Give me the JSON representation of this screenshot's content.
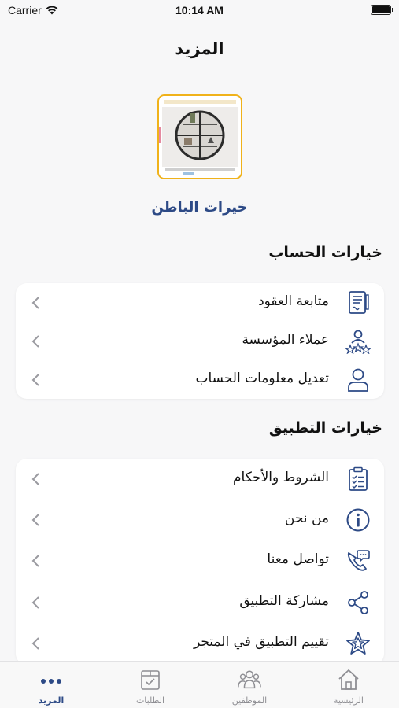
{
  "status": {
    "carrier": "Carrier",
    "time": "10:14 AM"
  },
  "header": {
    "title": "المزيد"
  },
  "profile": {
    "name": "خيرات الباطن"
  },
  "account_section": {
    "title": "خيارات الحساب",
    "items": [
      {
        "label": "متابعة العقود",
        "icon": "contract-icon"
      },
      {
        "label": "عملاء المؤسسة",
        "icon": "clients-icon"
      },
      {
        "label": "تعديل معلومات الحساب",
        "icon": "user-icon"
      }
    ]
  },
  "app_section": {
    "title": "خيارات التطبيق",
    "items": [
      {
        "label": "الشروط والأحكام",
        "icon": "clipboard-checklist-icon"
      },
      {
        "label": "من نحن",
        "icon": "info-icon"
      },
      {
        "label": "تواصل معنا",
        "icon": "phone-chat-icon"
      },
      {
        "label": "مشاركة التطبيق",
        "icon": "share-icon"
      },
      {
        "label": "تقييم التطبيق في المتجر",
        "icon": "star-icon"
      }
    ]
  },
  "tabs": [
    {
      "label": "الرئيسية",
      "icon": "home-icon"
    },
    {
      "label": "الموظفين",
      "icon": "employees-icon"
    },
    {
      "label": "الطلبات",
      "icon": "orders-box-icon"
    },
    {
      "label": "المزيد",
      "icon": "more-dots-icon",
      "active": true
    }
  ],
  "colors": {
    "accent": "#2d4a86",
    "logo_border": "#f0b21a",
    "background": "#f7f7f8"
  }
}
